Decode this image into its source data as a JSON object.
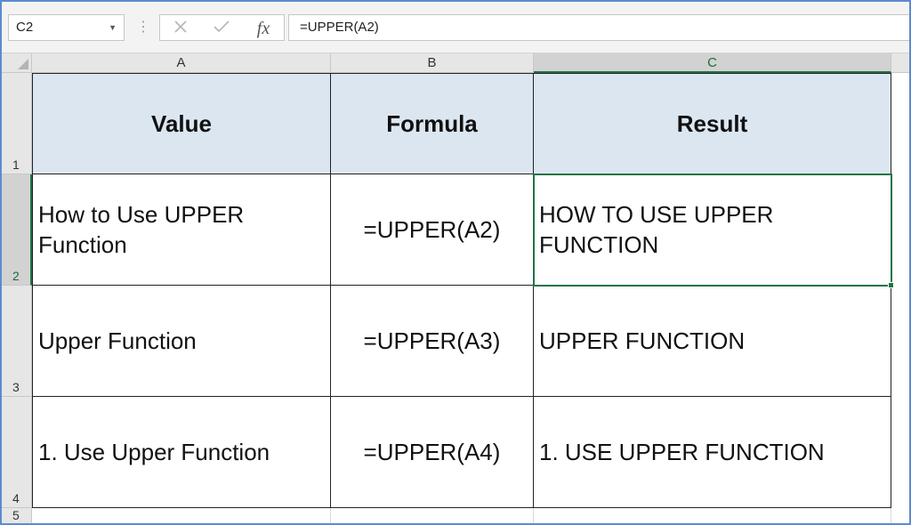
{
  "formula_bar": {
    "name_box": "C2",
    "separator": "⋮",
    "formula": "=UPPER(A2)",
    "fx_label": "fx"
  },
  "columns": [
    "A",
    "B",
    "C"
  ],
  "rows": [
    "1",
    "2",
    "3",
    "4",
    "5"
  ],
  "table": {
    "headers": [
      "Value",
      "Formula",
      "Result"
    ],
    "rows": [
      [
        "How to Use UPPER Function",
        "=UPPER(A2)",
        "HOW TO USE UPPER FUNCTION"
      ],
      [
        "Upper Function",
        "=UPPER(A3)",
        "UPPER FUNCTION"
      ],
      [
        "1. Use Upper Function",
        "=UPPER(A4)",
        "1. USE UPPER FUNCTION"
      ]
    ]
  },
  "colors": {
    "header_fill": "#dce6f1",
    "selection": "#217346"
  }
}
